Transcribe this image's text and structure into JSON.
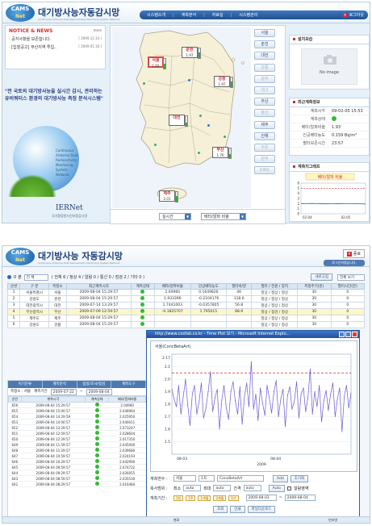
{
  "colors": {
    "brand": "#1c3f7a",
    "nav": "#2e64a8",
    "accent_red": "#dd2222",
    "good": "#33bb33",
    "plot_line": "#6a5ad0",
    "threshold": "#dd2222"
  },
  "top": {
    "logo": {
      "line1": "CAMS",
      "line2": "Net"
    },
    "brand_title": "대기방사능자동감시망",
    "brand_subtitle": "Continuous Airborne Dust Radioactivity Monitoring System Network",
    "nav": [
      "시스템소개",
      "계측분석",
      "자료실",
      "시스템관리"
    ],
    "logout": "로그아웃",
    "notice": {
      "title": "NOTICE & NEWS",
      "more": "more",
      "items": [
        {
          "text": "· 공지사항을 보존합니다.",
          "date": "[ 2009.12.14 ]"
        },
        {
          "text": "· [입찰공고] 부산지역 투입..",
          "date": "[ 2009.01.16 ]"
        }
      ]
    },
    "slogan": "\"전 국토의 대기방사능을 실시간 감시, 관리하는 유비쿼터스 환경의 대기방사능 측정 분석시스템\"",
    "globe_text": [
      "Continuous",
      "Airborne Dust Radioactivity",
      "Monitoring",
      "System",
      "Network"
    ],
    "iernet": "IERNet",
    "iernet_sub": "국가환경방사선자동감시망",
    "stations": [
      {
        "name": "춘천",
        "value": "1.97",
        "level": 0.6
      },
      {
        "name": "서울",
        "value": "1.93",
        "level": 0.5
      },
      {
        "name": "강릉",
        "value": "1.97",
        "level": 0.55
      },
      {
        "name": "대전",
        "value": "",
        "level": 0.3
      },
      {
        "name": "부산",
        "value": "1.76",
        "level": 0.45
      },
      {
        "name": "제주",
        "value": "2.01",
        "level": 0.6
      }
    ],
    "region_buttons": [
      {
        "label": "서울",
        "active": true
      },
      {
        "label": "춘천",
        "active": true
      },
      {
        "label": "대전",
        "active": true
      },
      {
        "label": "강릉",
        "active": false
      },
      {
        "label": "광주",
        "active": false
      },
      {
        "label": "대구",
        "active": false
      },
      {
        "label": "부산",
        "active": true
      },
      {
        "label": "울산",
        "active": false
      },
      {
        "label": "제주",
        "active": true
      },
      {
        "label": "진해",
        "active": true
      },
      {
        "label": "수원",
        "active": false
      },
      {
        "label": "원주",
        "active": false
      },
      {
        "label": "KINS",
        "active": false
      }
    ],
    "map_select_1": "실시간",
    "map_select_2": "베타/알파 비율",
    "photo_panel": {
      "title": "설치모습",
      "no_image": "No image"
    },
    "latest_panel": {
      "title": "최근계측정보",
      "rows": [
        {
          "k": "계측시각",
          "v": "09-02-05 15:53"
        },
        {
          "k": "계측상태",
          "v": ""
        },
        {
          "k": "베타/알파비율",
          "v": "1.93"
        },
        {
          "k": "인공베타농도",
          "v": "0.159 Bq/m³"
        },
        {
          "k": "필터보존시간",
          "v": "23:57"
        }
      ]
    },
    "graph_panel": {
      "title": "계측치그래프",
      "mini_title": "베타/알파 비율",
      "y_ticks": [
        "6",
        "5",
        "4",
        "3",
        "2",
        "1",
        "0"
      ],
      "x_ticks": [
        "02-04",
        "02-05"
      ]
    }
  },
  "bottom": {
    "logo": {
      "line1": "CAMS",
      "line2": "Net"
    },
    "brand_title": "대기방사능 자동감시망",
    "brand_subtitle": "Continuous Airborne Dust Radioactivity Monitoring System Network",
    "close": "종료",
    "login_status": "로그인하였습니다.",
    "filter": {
      "label": "구 분",
      "value": "전 체",
      "summary": "( 전체 6 / 정상 4 / 알람 0 / 통신 0 / 점검 2 / 기타 0 )",
      "refresh": "새로고침",
      "view": "전체 보기"
    },
    "table_headers": [
      "순번",
      "구 분",
      "측정소",
      "최근계측시각",
      "계측상태",
      "베타/알파비율",
      "인공베타농도",
      "필터비/분",
      "필터 / 전원 / 장치",
      "측정주기(분)",
      "필터시간(분)"
    ],
    "table_rows": [
      [
        "1",
        "서울특별시",
        "서울",
        "2009-08-04 15:29:57",
        "",
        "2.04960",
        "0.1649826",
        "46",
        "정상 / 정상 / 정상",
        "30",
        "0"
      ],
      [
        "2",
        "강원도",
        "춘천",
        "2009-08-04 15:29:57",
        "",
        "1.933396",
        "-0.2104176",
        "118.6",
        "정상 / 정상 / 정상",
        "30",
        "0"
      ],
      [
        "3",
        "대전광역시",
        "대전",
        "2009-07-14 13:29:57",
        "",
        "1.7441003",
        "-0.0357805",
        "56.8",
        "정상 / 정상 / 정상",
        "30",
        "0"
      ],
      [
        "4",
        "부산광역시",
        "부산",
        "2009-07-09 12:59:57",
        "",
        "-0.1825707",
        "1.795615",
        "88.9",
        "정상 / 점검 / 정상",
        "30",
        "0"
      ],
      [
        "5",
        "제주도",
        "제주",
        "2009-08-04 15:29:57",
        "",
        "",
        "",
        "",
        "정상 / 정상 / 정상",
        "30",
        "0"
      ],
      [
        "6",
        "강원도",
        "강릉",
        "2009-08-04 15:29:57",
        "",
        "",
        "",
        "",
        "정상 / 정상 / 정상",
        "30",
        "0"
      ]
    ],
    "list_tabs": [
      "이기분류",
      "계측분석",
      "탐방/조사/점검",
      "계측도구"
    ],
    "list_filter": {
      "station": "측정소 : 서울",
      "period_label": "계측기간",
      "from": "2009-07-22",
      "to": "2009-08-04"
    },
    "list_headers": [
      "순번",
      "계측시각",
      "계측상태",
      "베타/알파비율"
    ],
    "list_rows": [
      [
        "656",
        "2009-08-04 15:29:57",
        "2.04960"
      ],
      [
        "655",
        "2009-08-04 15:00:57",
        "2.046964"
      ],
      [
        "654",
        "2009-08-04 14:29:59",
        "2.025950"
      ],
      [
        "653",
        "2009-08-04 14:00:57",
        "2.040011"
      ],
      [
        "652",
        "2009-08-04 13:29:57",
        "2.073247"
      ],
      [
        "651",
        "2009-08-04 12:59:57",
        "2.028604"
      ],
      [
        "650",
        "2009-08-04 12:29:57",
        "2.017350"
      ],
      [
        "649",
        "2009-08-04 11:59:57",
        "2.045000"
      ],
      [
        "648",
        "2009-08-04 11:29:57",
        "2.039680"
      ],
      [
        "647",
        "2009-08-04 10:59:57",
        "2.024193"
      ],
      [
        "646",
        "2009-08-04 10:29:57",
        "2.042990"
      ],
      [
        "645",
        "2009-08-04 09:59:57",
        "2.074722"
      ],
      [
        "644",
        "2009-08-04 09:29:57",
        "2.026055"
      ],
      [
        "643",
        "2009-08-04 08:59:57",
        "2.035530"
      ],
      [
        "642",
        "2009-08-04 08:29:57",
        "2.016484"
      ]
    ],
    "popup": {
      "title": "http://www.cosfab.co.kr - Time Plot 보기 - Microsoft Internet Explo...",
      "chart_title": "서울(ConcBetaArt)",
      "controls": {
        "var_label": "계측변수 :",
        "var1": "서울",
        "var2": "1차",
        "var3": "ConcBetaArt",
        "add": "Add",
        "clear": "초기화",
        "axis_label": "축서범위 :",
        "min_label": "최소",
        "min_val": "auto",
        "max_label": "최대",
        "max_val": "auto",
        "step_label": "간격",
        "step_val": "auto",
        "auto": "Auto",
        "alarm": "알람영역",
        "period_label": "계측기간 :",
        "chips": [
          "1일",
          "1주",
          "1개월",
          "3개월",
          "1년"
        ],
        "from": "2009-08-03",
        "to": "2009-08-04",
        "query": "조회",
        "print": "인쇄",
        "excel": "파일다운로드"
      }
    },
    "status_bar": {
      "left": "완료",
      "right": "인터넷"
    }
  },
  "chart_data": [
    {
      "type": "line",
      "title": "서울(ConcBetaArt)",
      "x_ticks": [
        "08-03",
        "08-04"
      ],
      "xlabel": "2009",
      "ylim": [
        1.4,
        2.2
      ],
      "y_ticks": [
        "2.17",
        "2.1",
        "2.0",
        "1.9",
        "1.8",
        "1.7",
        "1.6",
        "1.5"
      ],
      "threshold": 2.05,
      "series": [
        {
          "values": [
            1.92,
            1.84,
            1.78,
            1.95,
            1.72,
            1.86,
            2.0,
            1.79,
            1.63,
            1.88,
            1.95,
            1.72,
            1.82,
            1.97,
            1.69,
            1.77,
            1.9,
            2.06,
            1.74,
            1.85,
            1.92,
            1.6,
            1.83,
            1.95,
            1.77,
            1.68,
            1.9,
            1.98,
            1.82,
            1.72,
            1.94,
            1.64,
            1.86,
            1.97,
            1.78,
            2.14,
            1.76,
            1.88,
            1.67,
            1.93,
            1.81,
            1.71,
            1.95,
            1.85,
            1.73,
            1.9,
            1.99,
            1.7,
            1.84,
            1.92,
            1.62,
            1.87,
            1.94,
            1.76,
            1.82,
            1.98,
            1.69,
            1.88,
            1.93,
            1.74,
            1.85,
            2.08,
            1.72,
            1.9,
            1.78,
            1.95,
            1.66,
            1.83,
            1.91,
            1.75,
            1.88,
            1.97,
            1.7,
            1.84,
            1.93,
            1.58,
            1.86,
            1.95,
            1.77,
            1.89
          ]
        }
      ]
    },
    {
      "type": "line",
      "title": "베타/알파 비율",
      "x_ticks": [
        "02-04",
        "02-05"
      ],
      "ylim": [
        0,
        6
      ],
      "y_ticks": [
        "6",
        "5",
        "4",
        "3",
        "2",
        "1",
        "0"
      ],
      "threshold": 5,
      "series": [
        {
          "values": [
            2.0,
            1.95,
            2.02,
            1.97,
            2.0,
            1.94,
            1.98,
            2.01,
            1.96,
            1.99,
            2.0,
            1.95,
            1.93
          ]
        }
      ]
    }
  ]
}
